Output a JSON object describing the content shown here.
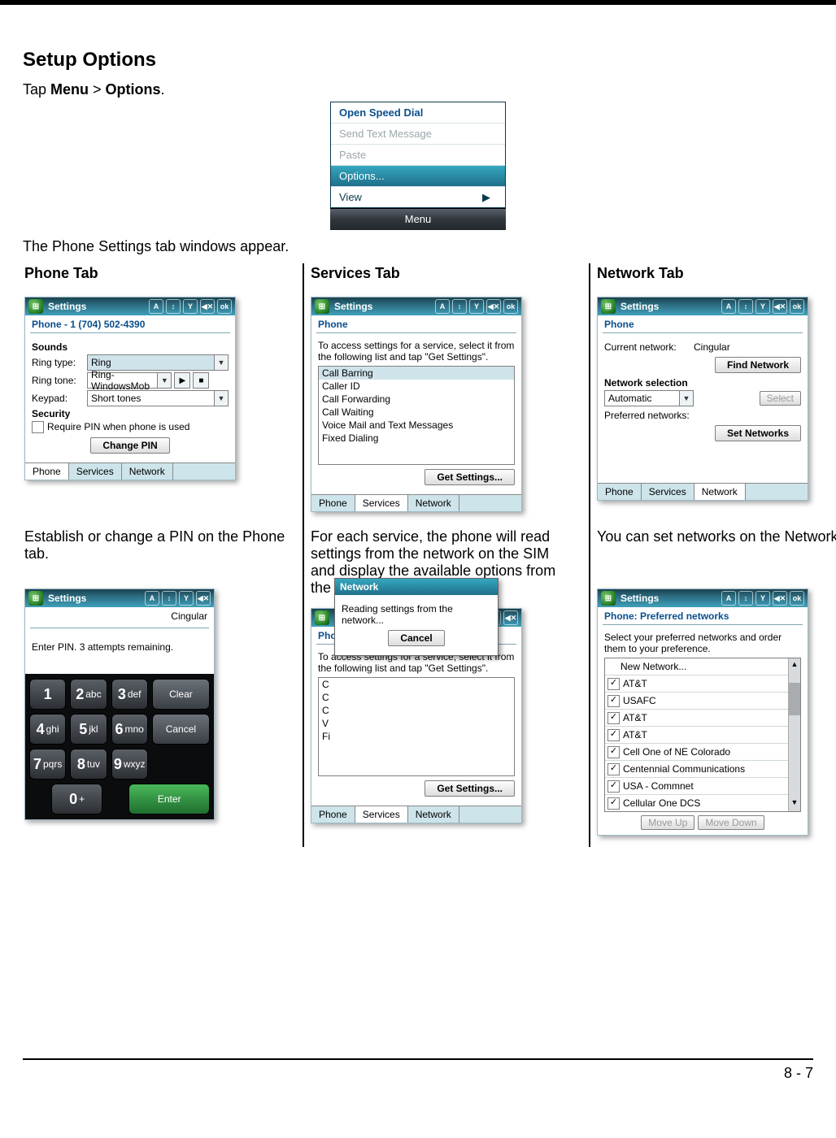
{
  "heading": "Setup Options",
  "lead_pre": "Tap ",
  "lead_menu": "Menu",
  "lead_gt": " > ",
  "lead_opt": "Options",
  "lead_post": ".",
  "after_menu": "The Phone Settings tab windows appear.",
  "footer": "8 - 7",
  "top_menu": {
    "items": [
      "Open Speed Dial",
      "Send Text Message",
      "Paste",
      "Options...",
      "View"
    ],
    "bar": "Menu"
  },
  "tb_settings": "Settings",
  "tb_icons_set": [
    "A",
    "↕",
    "Y",
    "◀✕",
    "ok"
  ],
  "tb_icons": [
    "A",
    "↕",
    "Y",
    "◀✕"
  ],
  "tabs_labels": {
    "phone": "Phone",
    "services": "Services",
    "network": "Network"
  },
  "col1": {
    "title": "Phone Tab",
    "shot1": {
      "sub": "Phone - 1 (704) 502-4390",
      "sounds": "Sounds",
      "ring_type_lbl": "Ring type:",
      "ring_type_val": "Ring",
      "ring_tone_lbl": "Ring tone:",
      "ring_tone_val": "Ring-WindowsMob",
      "keypad_lbl": "Keypad:",
      "keypad_val": "Short tones",
      "security": "Security",
      "pin_chk": "Require PIN when phone is used",
      "change_pin": "Change PIN"
    },
    "cap": "Establish or change a PIN on the Phone tab.",
    "shot2": {
      "carrier": "Cingular",
      "enter_pin": "Enter PIN. 3 attempts remaining.",
      "keys": {
        "r1": [
          [
            "1",
            ""
          ],
          [
            "2",
            "abc"
          ],
          [
            "3",
            "def"
          ],
          [
            "Clear",
            ""
          ]
        ],
        "r2": [
          [
            "4",
            "ghi"
          ],
          [
            "5",
            "jkl"
          ],
          [
            "6",
            "mno"
          ],
          [
            "Cancel",
            ""
          ]
        ],
        "r3": [
          [
            "7",
            "pqrs"
          ],
          [
            "8",
            "tuv"
          ],
          [
            "9",
            "wxyz"
          ],
          [
            "",
            ""
          ]
        ],
        "r4": [
          [
            "0",
            "+"
          ],
          [
            "Enter",
            ""
          ]
        ]
      }
    }
  },
  "col2": {
    "title": "Services Tab",
    "shot1": {
      "sub": "Phone",
      "instr": "To access settings for a service, select it from the following list and tap \"Get Settings\".",
      "list": [
        "Call Barring",
        "Caller ID",
        "Call Forwarding",
        "Call Waiting",
        "Voice Mail and Text Messages",
        "Fixed Dialing"
      ],
      "get": "Get Settings..."
    },
    "cap": "For each service, the phone will read settings from the network on the SIM and display the available options from the carrier.",
    "shot2": {
      "dlg_title": "Network",
      "dlg_text": "Reading settings from the network...",
      "cancel": "Cancel"
    }
  },
  "col3": {
    "title": "Network Tab",
    "shot1": {
      "sub": "Phone",
      "cur_net_lbl": "Current network:",
      "cur_net_val": "Cingular",
      "find": "Find Network",
      "sel_hd": "Network selection",
      "sel_val": "Automatic",
      "select_btn": "Select",
      "pref_lbl": "Preferred networks:",
      "set_btn": "Set Networks"
    },
    "cap": "You can set networks on the Network tab.",
    "shot2": {
      "sub": "Phone: Preferred networks",
      "instr": "Select your preferred networks and order them to your preference.",
      "first": "New Network...",
      "rows": [
        "AT&T",
        "USAFC",
        "AT&T",
        "AT&T",
        "Cell One of NE Colorado",
        "Centennial Communications",
        "USA - Commnet",
        "Cellular One DCS"
      ],
      "moveup": "Move Up",
      "movedn": "Move Down"
    }
  }
}
